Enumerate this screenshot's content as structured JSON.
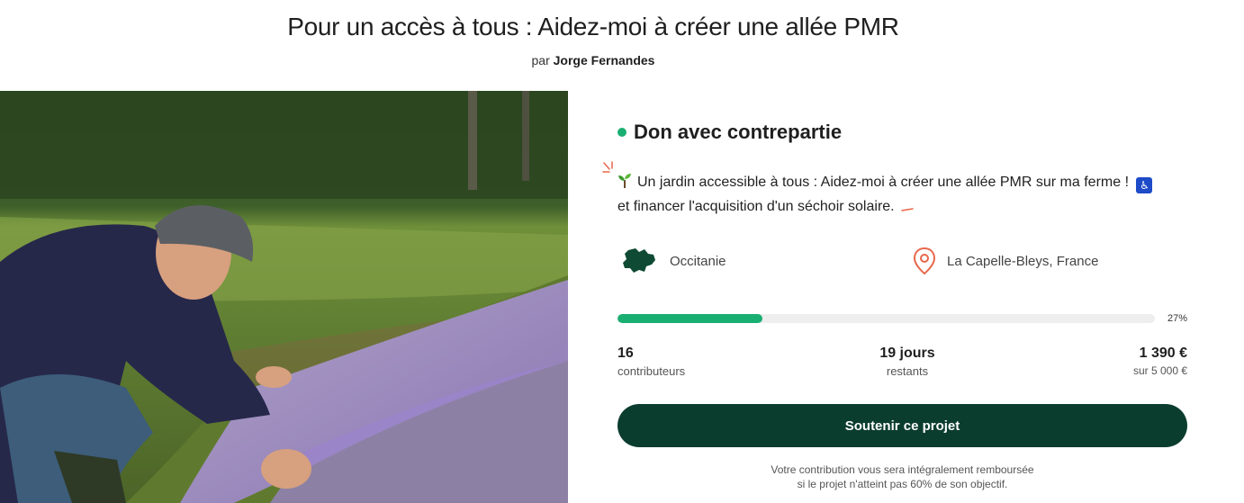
{
  "header": {
    "title": "Pour un accès à tous : Aidez-moi à créer une allée PMR",
    "by_prefix": "par",
    "author": "Jorge Fernandes"
  },
  "project": {
    "type_label": "Don avec contrepartie",
    "description_line1": "Un jardin accessible à tous : Aidez-moi à créer une allée PMR sur ma ferme !",
    "description_line2": "et financer l'acquisition d'un séchoir solaire.",
    "region": "Occitanie",
    "city": "La Capelle-Bleys, France"
  },
  "funding": {
    "progress_percent": 27,
    "progress_label": "27%",
    "contributors_count": "16",
    "contributors_label": "contributeurs",
    "days_value": "19 jours",
    "days_label": "restants",
    "amount_raised": "1 390 €",
    "goal_label": "sur 5 000 €"
  },
  "cta": {
    "label": "Soutenir ce projet"
  },
  "note": {
    "line1": "Votre contribution vous sera intégralement remboursée",
    "line2": "si le projet n'atteint pas 60% de son objectif."
  },
  "colors": {
    "accent_green": "#1aaf72",
    "button_dark_green": "#0b3d2e",
    "location_pin": "#e8664a"
  },
  "icons": {
    "type": "green-dot-icon",
    "sprout": "sprout-icon",
    "accessibility": "wheelchair-icon",
    "region": "occitanie-map-icon",
    "city": "location-pin-icon"
  }
}
